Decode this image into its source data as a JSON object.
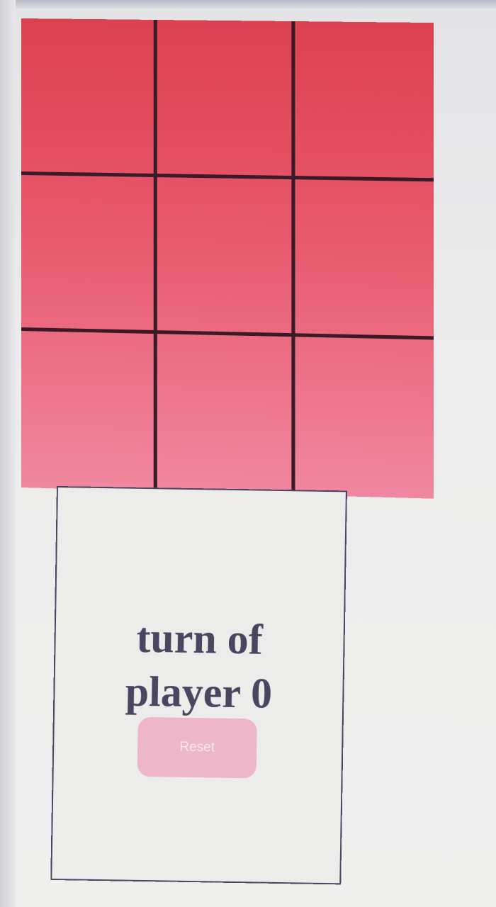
{
  "board": {
    "cells": [
      "",
      "",
      "",
      "",
      "",
      "",
      "",
      "",
      ""
    ],
    "colors": {
      "top": "#dc4150",
      "bottom": "#f087a0",
      "grid_line": "#3a1a26"
    }
  },
  "status": {
    "turn_label": "turn of\nplayer 0"
  },
  "controls": {
    "reset_label": "Reset",
    "reset_color": "#eeb6c9"
  }
}
